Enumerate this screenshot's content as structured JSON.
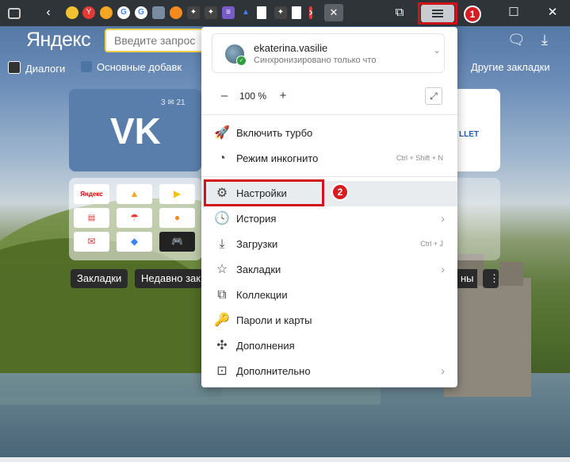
{
  "toolbar": {
    "tab_icons": [
      "sidebar-icon",
      "back-arrow-icon",
      "pin-icon",
      "yandex-y-icon",
      "orange-circle-icon",
      "google-icon",
      "google-icon",
      "book-icon",
      "ok-icon",
      "sparkle-icon",
      "sparkle-icon",
      "strikethrough-icon",
      "triangle-icon",
      "page-icon",
      "sparkle-icon",
      "page-icon",
      "red-marker-icon",
      "forward-arrow-icon",
      "close-tab-icon"
    ],
    "badge_1": "1",
    "badge_2": "2"
  },
  "header": {
    "logo": "Яндекс",
    "search_placeholder": "Введите запрос",
    "search_value": ""
  },
  "bookmarks_bar": {
    "items": [
      {
        "label": "Диалоги"
      },
      {
        "label": "Основные добавк"
      },
      {
        "label": "Другие закладки"
      }
    ]
  },
  "tiles": {
    "vk_stats": "3 ✉ 21",
    "wallet_label": "LLET",
    "grid_cells": [
      "Яндекс",
      "",
      "",
      "",
      "",
      "",
      "",
      "",
      ""
    ],
    "chips": [
      "Закладки",
      "Недавно зак",
      "ны"
    ]
  },
  "menu": {
    "profile": {
      "name": "ekaterina.vasilie",
      "sync_status": "Синхронизировано только что"
    },
    "zoom": {
      "minus": "–",
      "value": "100 %",
      "plus": "+"
    },
    "items": [
      {
        "label": "Включить турбо",
        "shortcut": ""
      },
      {
        "label": "Режим инкогнито",
        "shortcut": "Ctrl + Shift + N"
      },
      {
        "label": "Настройки",
        "shortcut": ""
      },
      {
        "label": "История",
        "shortcut": ""
      },
      {
        "label": "Загрузки",
        "shortcut": "Ctrl + J"
      },
      {
        "label": "Закладки",
        "shortcut": ""
      },
      {
        "label": "Коллекции",
        "shortcut": ""
      },
      {
        "label": "Пароли и карты",
        "shortcut": ""
      },
      {
        "label": "Дополнения",
        "shortcut": ""
      },
      {
        "label": "Дополнительно",
        "shortcut": ""
      }
    ]
  },
  "colors": {
    "highlight": "#d0141a",
    "titlebar": "#2f3439",
    "accent_yellow": "#f7d04a"
  }
}
